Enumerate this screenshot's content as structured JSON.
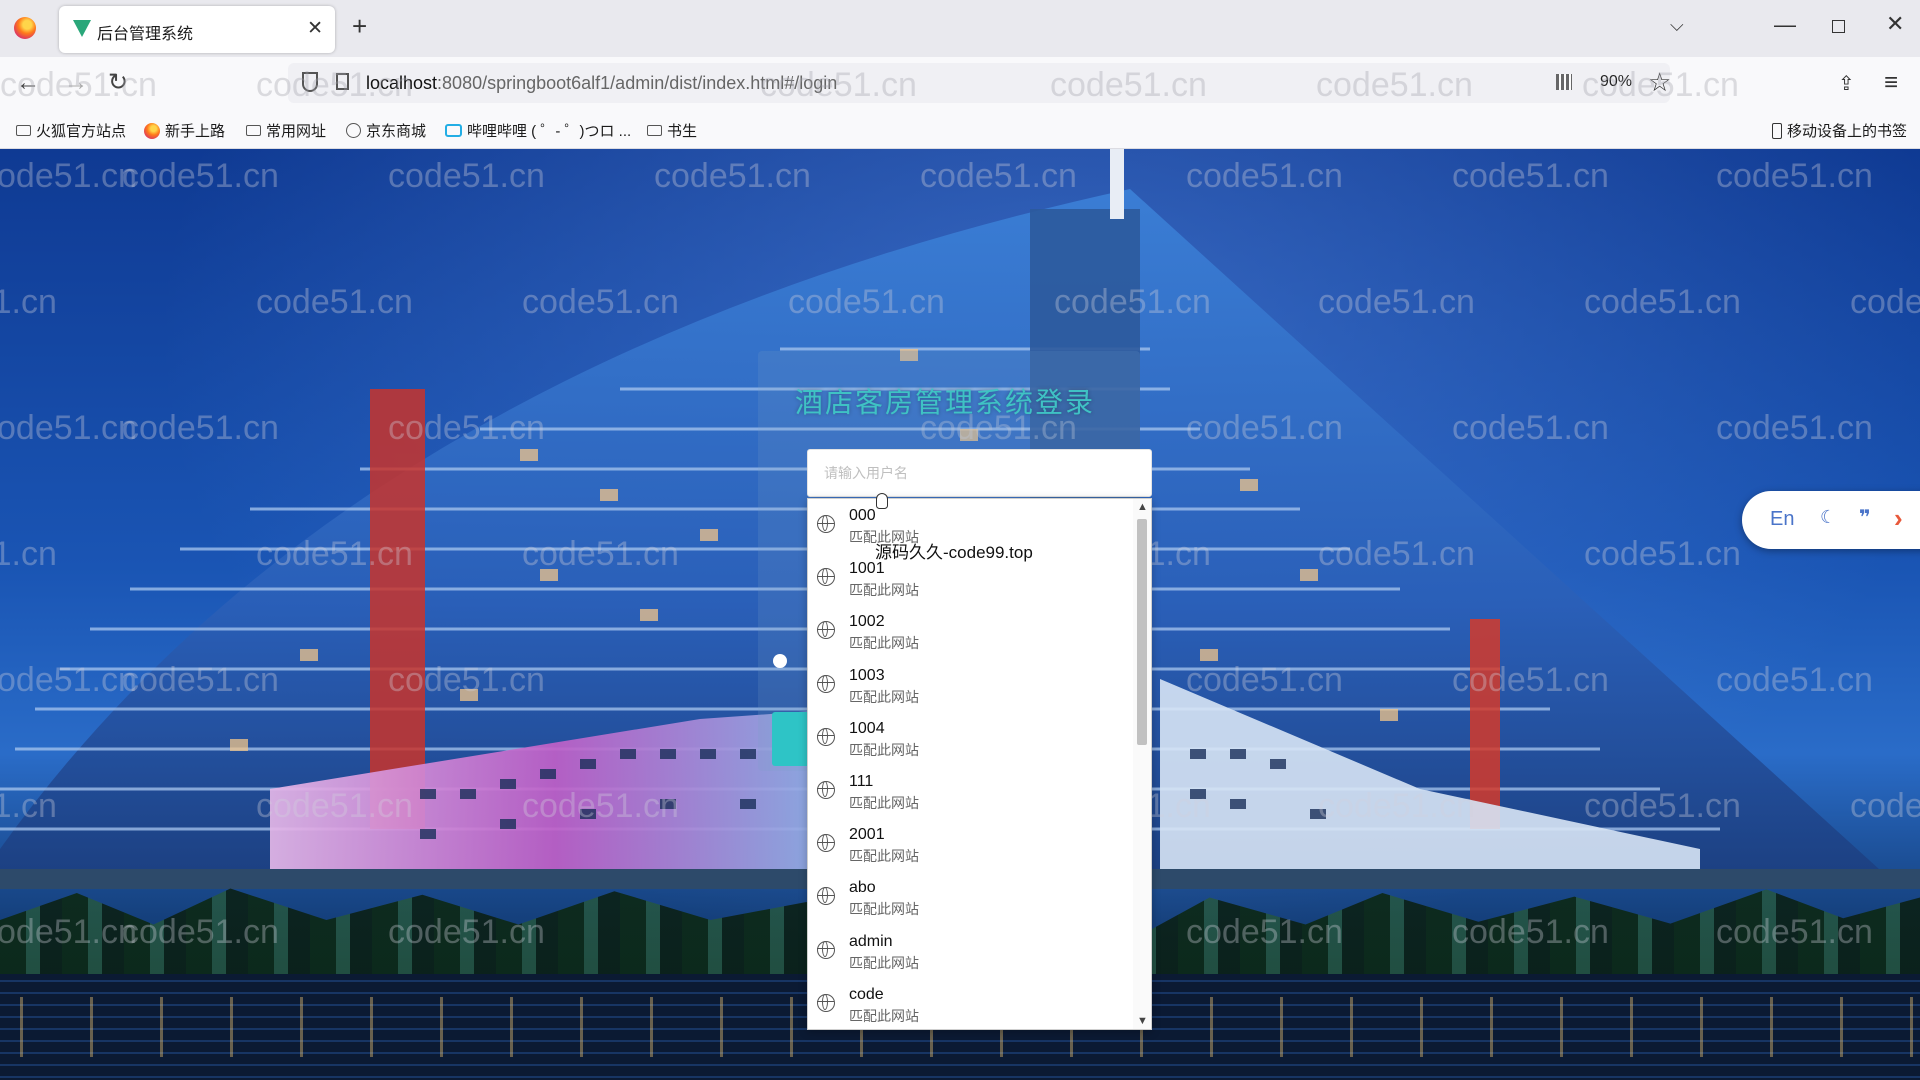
{
  "browser": {
    "tab_title": "后台管理系统",
    "tab_close": "✕",
    "new_tab": "+",
    "tabs_menu": "⌵",
    "win_min": "—",
    "win_close": "✕",
    "back": "←",
    "forward": "→",
    "reload": "↻",
    "url_host": "localhost",
    "url_rest": ":8080/springboot6alf1/admin/dist/index.html#/login",
    "zoom": "90%",
    "star": "☆",
    "ext": "⇪",
    "menu": "≡"
  },
  "bookmarks": {
    "items": [
      {
        "label": "火狐官方站点",
        "icon": "folder-icon"
      },
      {
        "label": "新手上路",
        "icon": "firefox-icon"
      },
      {
        "label": "常用网址",
        "icon": "folder-icon"
      },
      {
        "label": "京东商城",
        "icon": "globe-icon"
      },
      {
        "label": "哔哩哔哩 ( ゜- ゜)つロ ...",
        "icon": "bilibili-icon"
      },
      {
        "label": "书生",
        "icon": "folder-icon"
      }
    ],
    "mobile": "移动设备上的书签"
  },
  "page": {
    "watermark": "code51.cn",
    "title": "酒店客房管理系统登录",
    "username_placeholder": "请输入用户名",
    "overlay_text": "源码久久-code99.top"
  },
  "autocomplete": {
    "items": [
      {
        "value": "000",
        "sub": "匹配此网站"
      },
      {
        "value": "1001",
        "sub": "匹配此网站"
      },
      {
        "value": "1002",
        "sub": "匹配此网站"
      },
      {
        "value": "1003",
        "sub": "匹配此网站"
      },
      {
        "value": "1004",
        "sub": "匹配此网站"
      },
      {
        "value": "111",
        "sub": "匹配此网站"
      },
      {
        "value": "2001",
        "sub": "匹配此网站"
      },
      {
        "value": "abo",
        "sub": "匹配此网站"
      },
      {
        "value": "admin",
        "sub": "匹配此网站"
      },
      {
        "value": "code",
        "sub": "匹配此网站"
      }
    ],
    "scroll_up": "▲",
    "scroll_down": "▼"
  },
  "widget": {
    "lang": "En",
    "moon": "☾",
    "quote": "❞",
    "chevron": "›"
  },
  "colors": {
    "accent": "#2ec4c6",
    "title_color": "#3fc2c4",
    "widget_blue": "#4a74c9",
    "widget_chevron": "#e8593b"
  }
}
